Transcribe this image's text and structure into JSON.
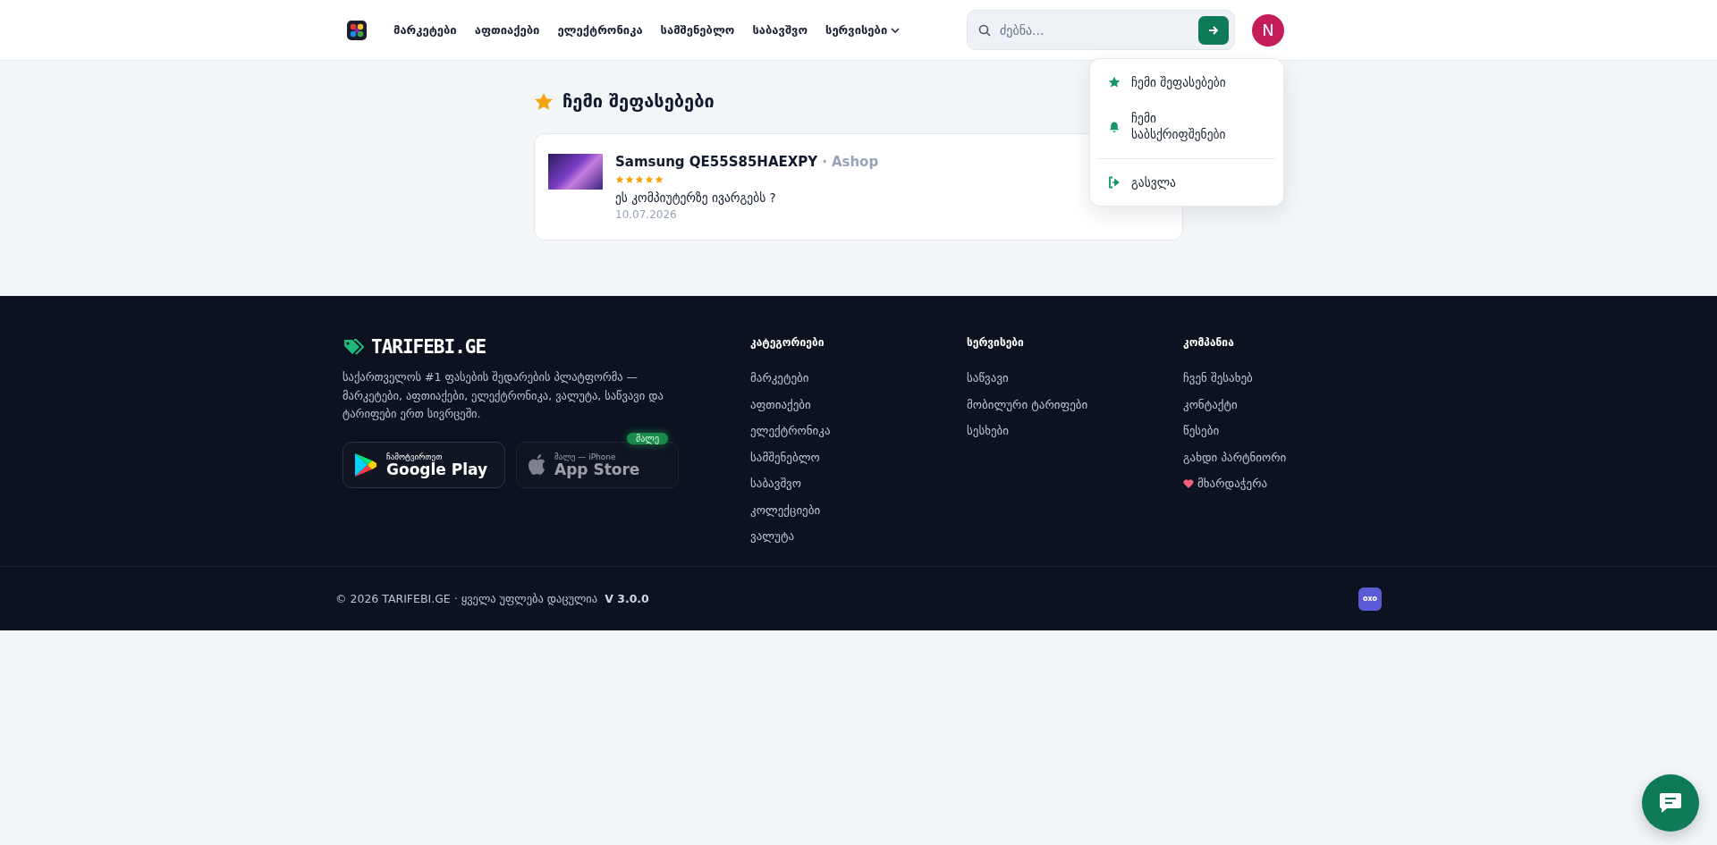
{
  "header": {
    "nav": [
      {
        "label": "მარკეტები",
        "dropdown": false
      },
      {
        "label": "აფთიაქები",
        "dropdown": false
      },
      {
        "label": "ელექტრონიკა",
        "dropdown": false
      },
      {
        "label": "სამშენებლო",
        "dropdown": false
      },
      {
        "label": "საბავშვო",
        "dropdown": false
      },
      {
        "label": "სერვისები",
        "dropdown": true
      }
    ],
    "search": {
      "placeholder": "ძებნა..."
    },
    "avatar": "N"
  },
  "user_menu": {
    "items": [
      {
        "kind": "star",
        "label": "ჩემი შეფასებები"
      },
      {
        "kind": "bell",
        "label": "ჩემი საბსქრიფშენები"
      },
      {
        "kind": "logout",
        "label": "გასვლა"
      }
    ]
  },
  "reviews": {
    "title": "ჩემი შეფასებები",
    "items": [
      {
        "product": "Samsung QE55S85HAEXPY",
        "separator": "·",
        "shop": "Ashop",
        "stars": 5,
        "text": "ეს კომპიუტერზე ივარგებს ?",
        "date": "10.07.2026"
      }
    ]
  },
  "footer": {
    "brand": "TARIFEBI.GE",
    "description": "საქართველოს #1 ფასების შედარების პლატფორმა — მარკეტები, აფთიაქები, ელექტრონიკა, ვალუტა, საწვავი და ტარიფები ერთ სივრცეში.",
    "stores": [
      {
        "kind": "google",
        "small": "ჩამოტვირთეთ",
        "big": "Google Play"
      },
      {
        "kind": "apple",
        "small": "მალე — iPhone",
        "big": "App Store",
        "badge": "მალე"
      }
    ],
    "columns": [
      {
        "heading": "კატეგორიები",
        "links": [
          {
            "label": "მარკეტები",
            "kind": "text"
          },
          {
            "label": "აფთიაქები",
            "kind": "text"
          },
          {
            "label": "ელექტრონიკა",
            "kind": "text"
          },
          {
            "label": "სამშენებლო",
            "kind": "text"
          },
          {
            "label": "საბავშვო",
            "kind": "text"
          },
          {
            "label": "კოლექციები",
            "kind": "text"
          },
          {
            "label": "ვალუტა",
            "kind": "text"
          }
        ]
      },
      {
        "heading": "სერვისები",
        "links": [
          {
            "label": "საწვავი",
            "kind": "text"
          },
          {
            "label": "მობილური ტარიფები",
            "kind": "text"
          },
          {
            "label": "სესხები",
            "kind": "text"
          }
        ]
      },
      {
        "heading": "კომპანია",
        "links": [
          {
            "label": "ჩვენ შესახებ",
            "kind": "text"
          },
          {
            "label": "კონტაქტი",
            "kind": "text"
          },
          {
            "label": "წესები",
            "kind": "text"
          },
          {
            "label": "გახდი პარტნიორი",
            "kind": "text"
          },
          {
            "label": "მხარდაჭერა",
            "kind": "heart"
          }
        ]
      }
    ],
    "copyright": "© 2026 TARIFEBI.GE · ყველა უფლება დაცულია",
    "version": "V 3.0.0",
    "badge": "oxo"
  }
}
